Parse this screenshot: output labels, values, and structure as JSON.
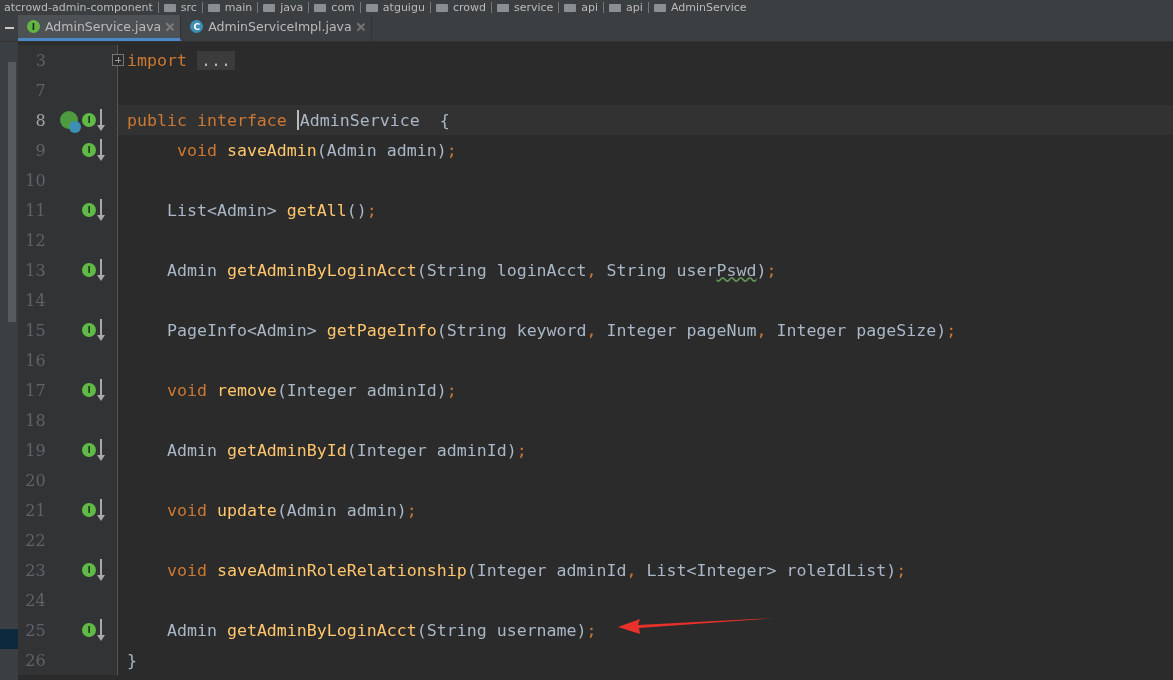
{
  "breadcrumb": [
    "atcrowd-admin-component",
    "src",
    "main",
    "java",
    "com",
    "atguigu",
    "crowd",
    "service",
    "api",
    "api",
    "AdminService"
  ],
  "tabs": [
    {
      "label": "AdminService.java",
      "badge": "I",
      "kind": "interface",
      "selected": true
    },
    {
      "label": "AdminServiceImpl.java",
      "badge": "C",
      "kind": "class",
      "selected": false
    }
  ],
  "lines": [
    {
      "number": "3",
      "current": false,
      "tokens": [
        {
          "kind": "keyword",
          "text": "import "
        },
        {
          "kind": "folded",
          "text": "..."
        }
      ]
    },
    {
      "number": "7",
      "current": false
    },
    {
      "number": "8",
      "kind": "bean",
      "badge": "I",
      "current": true,
      "tokens": [
        {
          "kind": "keyword",
          "text": "public interface "
        },
        {
          "kind": "plain",
          "text": "AdminService  {",
          "cursor": true
        }
      ]
    },
    {
      "number": "9",
      "kind": "implemented",
      "badge": "I",
      "current": false,
      "tokens": [
        {
          "kind": "keyword",
          "text": "     void "
        },
        {
          "kind": "method",
          "text": "saveAdmin"
        },
        {
          "kind": "plain",
          "text": "(Admin admin)"
        },
        {
          "kind": "keyword",
          "text": ";"
        }
      ]
    },
    {
      "number": "10",
      "current": false
    },
    {
      "number": "11",
      "kind": "implemented",
      "badge": "I",
      "current": false,
      "tokens": [
        {
          "kind": "plain",
          "text": "    List<Admin> "
        },
        {
          "kind": "method",
          "text": "getAll"
        },
        {
          "kind": "plain",
          "text": "()"
        },
        {
          "kind": "keyword",
          "text": ";"
        }
      ]
    },
    {
      "number": "12",
      "current": false
    },
    {
      "number": "13",
      "kind": "implemented",
      "badge": "I",
      "current": false,
      "tokens": [
        {
          "kind": "plain",
          "text": "    Admin "
        },
        {
          "kind": "method",
          "text": "getAdminByLoginAcct"
        },
        {
          "kind": "plain",
          "text": "(String loginAcct"
        },
        {
          "kind": "keyword",
          "text": ", "
        },
        {
          "kind": "plain",
          "text": "String user"
        },
        {
          "kind": "typo",
          "text": "Pswd"
        },
        {
          "kind": "plain",
          "text": ")"
        },
        {
          "kind": "keyword",
          "text": ";"
        }
      ]
    },
    {
      "number": "14",
      "current": false
    },
    {
      "number": "15",
      "kind": "implemented",
      "badge": "I",
      "current": false,
      "tokens": [
        {
          "kind": "plain",
          "text": "    PageInfo<Admin> "
        },
        {
          "kind": "method",
          "text": "getPageInfo"
        },
        {
          "kind": "plain",
          "text": "(String keyword"
        },
        {
          "kind": "keyword",
          "text": ", "
        },
        {
          "kind": "plain",
          "text": "Integer pageNum"
        },
        {
          "kind": "keyword",
          "text": ", "
        },
        {
          "kind": "plain",
          "text": "Integer pageSize)"
        },
        {
          "kind": "keyword",
          "text": ";"
        }
      ]
    },
    {
      "number": "16",
      "current": false
    },
    {
      "number": "17",
      "kind": "implemented",
      "badge": "I",
      "current": false,
      "tokens": [
        {
          "kind": "keyword",
          "text": "    void "
        },
        {
          "kind": "method",
          "text": "remove"
        },
        {
          "kind": "plain",
          "text": "(Integer adminId)"
        },
        {
          "kind": "keyword",
          "text": ";"
        }
      ]
    },
    {
      "number": "18",
      "current": false
    },
    {
      "number": "19",
      "kind": "implemented",
      "badge": "I",
      "current": false,
      "tokens": [
        {
          "kind": "plain",
          "text": "    Admin "
        },
        {
          "kind": "method",
          "text": "getAdminById"
        },
        {
          "kind": "plain",
          "text": "(Integer adminId)"
        },
        {
          "kind": "keyword",
          "text": ";"
        }
      ]
    },
    {
      "number": "20",
      "current": false
    },
    {
      "number": "21",
      "kind": "implemented",
      "badge": "I",
      "current": false,
      "tokens": [
        {
          "kind": "keyword",
          "text": "    void "
        },
        {
          "kind": "method",
          "text": "update"
        },
        {
          "kind": "plain",
          "text": "(Admin admin)"
        },
        {
          "kind": "keyword",
          "text": ";"
        }
      ]
    },
    {
      "number": "22",
      "current": false
    },
    {
      "number": "23",
      "kind": "implemented",
      "badge": "I",
      "current": false,
      "tokens": [
        {
          "kind": "keyword",
          "text": "    void "
        },
        {
          "kind": "method",
          "text": "saveAdminRoleRelationship"
        },
        {
          "kind": "plain",
          "text": "(Integer adminId"
        },
        {
          "kind": "keyword",
          "text": ", "
        },
        {
          "kind": "plain",
          "text": "List<Integer> roleIdList)"
        },
        {
          "kind": "keyword",
          "text": ";"
        }
      ]
    },
    {
      "number": "24",
      "current": false
    },
    {
      "number": "25",
      "kind": "implemented",
      "badge": "I",
      "current": false,
      "arrow": true,
      "tokens": [
        {
          "kind": "plain",
          "text": "    Admin "
        },
        {
          "kind": "method",
          "text": "getAdminByLoginAcct"
        },
        {
          "kind": "plain",
          "text": "(String username)"
        },
        {
          "kind": "keyword",
          "text": ";"
        }
      ]
    },
    {
      "number": "26",
      "current": false,
      "tokens": [
        {
          "kind": "plain",
          "text": "}"
        }
      ]
    }
  ]
}
